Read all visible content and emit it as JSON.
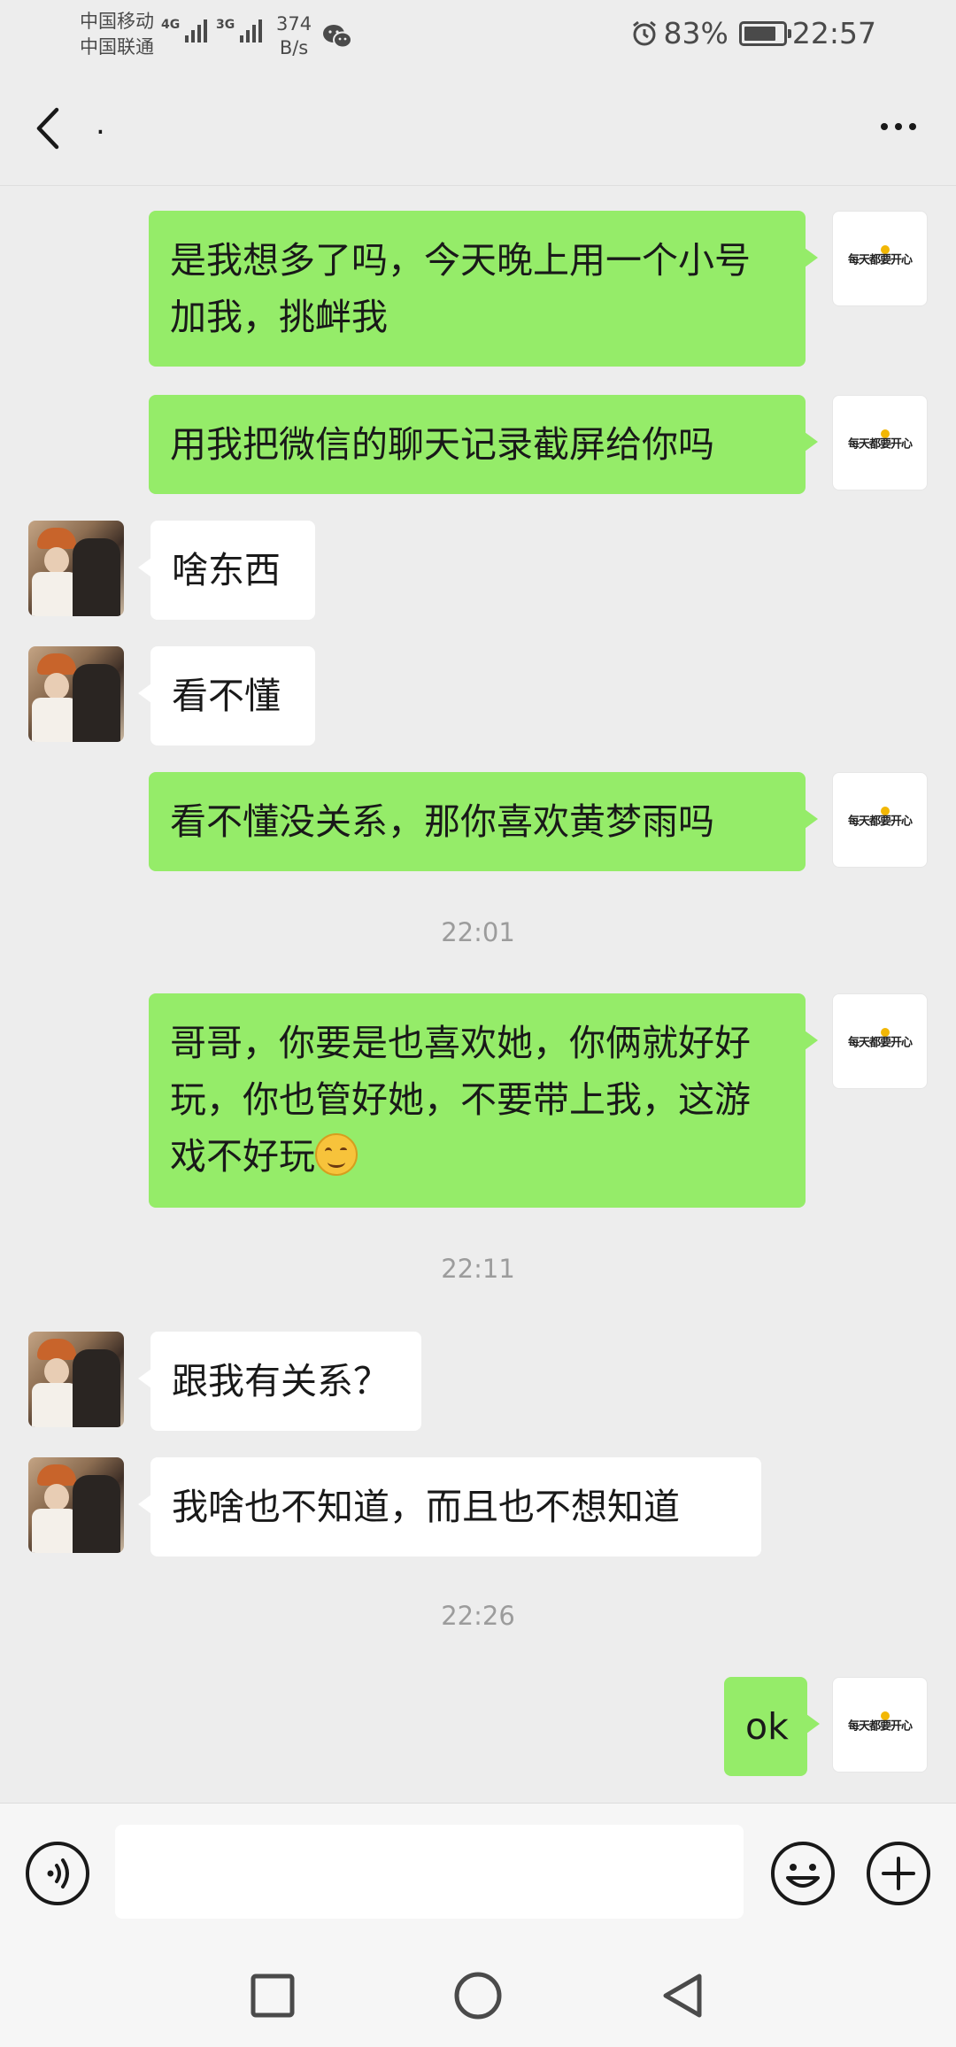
{
  "status_bar": {
    "carrier_1": "中国移动",
    "carrier_2": "中国联通",
    "signal_1_tag": "4G",
    "signal_2_tag": "3G",
    "net_speed_value": "374",
    "net_speed_unit": "B/s",
    "battery_percent": "83%",
    "battery_level": 0.83,
    "time": "22:57"
  },
  "header": {
    "title": "."
  },
  "self_avatar_text": "每天都要开心",
  "messages": [
    {
      "side": "self",
      "text": "是我想多了吗，今天晚上用一个小号加我，挑衅我"
    },
    {
      "side": "self",
      "text": "用我把微信的聊天记录截屏给你吗"
    },
    {
      "side": "friend",
      "text": "啥东西"
    },
    {
      "side": "friend",
      "text": "看不懂"
    },
    {
      "side": "self",
      "text": "看不懂没关系，那你喜欢黄梦雨吗"
    },
    {
      "timestamp": "22:01"
    },
    {
      "side": "self",
      "text": "哥哥，你要是也喜欢她，你俩就好好玩，你也管好她，不要带上我，这游戏不好玩",
      "emoji": "smile"
    },
    {
      "timestamp": "22:11"
    },
    {
      "side": "friend",
      "text": "跟我有关系？"
    },
    {
      "side": "friend",
      "text": "我啥也不知道，而且也不想知道"
    },
    {
      "timestamp": "22:26"
    },
    {
      "side": "self",
      "text": "ok"
    }
  ],
  "input": {
    "value": "",
    "placeholder": ""
  },
  "icons": {
    "back": "chevron-left-icon",
    "more": "more-dots-icon",
    "voice": "voice-icon",
    "emoji": "emoji-icon",
    "plus": "plus-icon",
    "nav_recent": "square-icon",
    "nav_home": "circle-icon",
    "nav_back": "triangle-back-icon"
  },
  "colors": {
    "self_bubble": "#95ec69",
    "friend_bubble": "#ffffff",
    "background": "#ededed"
  }
}
